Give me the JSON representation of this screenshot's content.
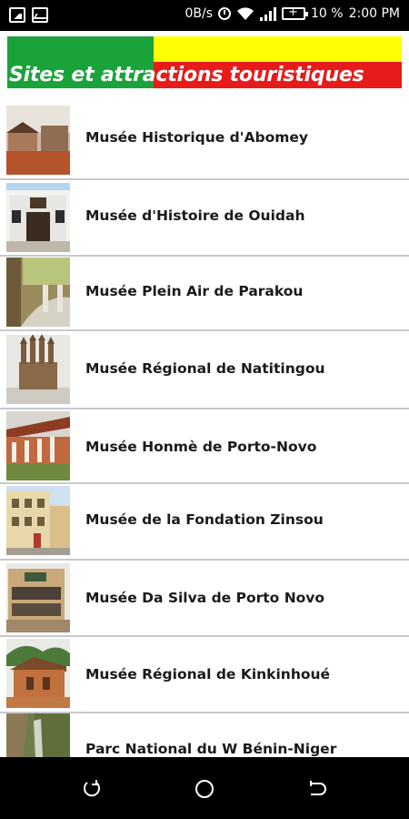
{
  "status_bar": {
    "net_speed": "0B/s",
    "battery_percent": "10 %",
    "time": "2:00 PM",
    "icons": [
      "gallery-icon",
      "pulse-icon",
      "clock-icon",
      "wifi-icon",
      "signal-icon",
      "battery-charging-icon"
    ]
  },
  "header": {
    "title": "Sites et attractions touristiques",
    "colors": {
      "green": "#1aa33a",
      "yellow": "#ffff00",
      "red": "#e81b1b"
    }
  },
  "sites": [
    {
      "label": "Musée Historique d'Abomey"
    },
    {
      "label": "Musée d'Histoire de Ouidah"
    },
    {
      "label": "Musée Plein Air de Parakou"
    },
    {
      "label": "Musée Régional de Natitingou"
    },
    {
      "label": "Musée Honmè de Porto-Novo"
    },
    {
      "label": "Musée de la Fondation Zinsou"
    },
    {
      "label": "Musée Da Silva de Porto Novo"
    },
    {
      "label": "Musée Régional de Kinkinhoué"
    },
    {
      "label": "Parc National du W Bénin-Niger"
    }
  ],
  "nav_bar": {
    "icons": [
      "recent-apps-icon",
      "home-icon",
      "back-icon"
    ]
  }
}
